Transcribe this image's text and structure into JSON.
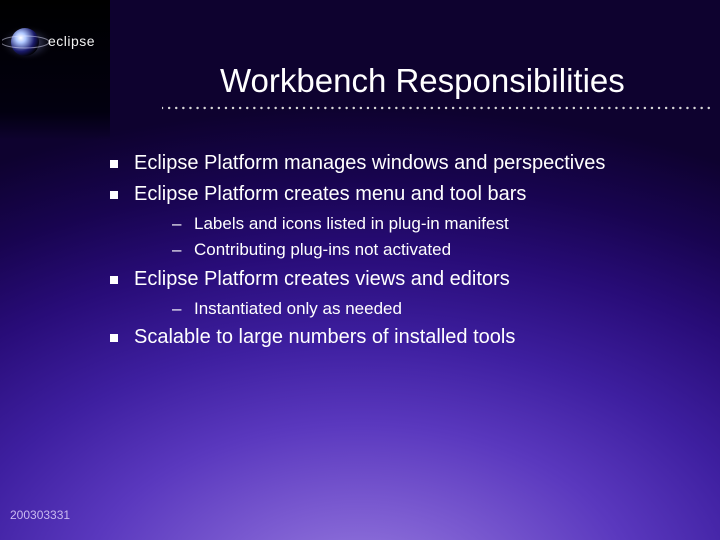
{
  "logo_text": "eclipse",
  "title": "Workbench Responsibilities",
  "bullets": [
    {
      "text": "Eclipse Platform manages windows and perspectives"
    },
    {
      "text": "Eclipse Platform creates menu and tool bars",
      "sub": [
        "Labels and icons listed in plug-in manifest",
        "Contributing plug-ins not activated"
      ]
    },
    {
      "text": "Eclipse Platform creates views and editors",
      "sub": [
        "Instantiated only as needed"
      ]
    },
    {
      "text": "Scalable to large numbers of installed tools"
    }
  ],
  "footer": "200303331"
}
